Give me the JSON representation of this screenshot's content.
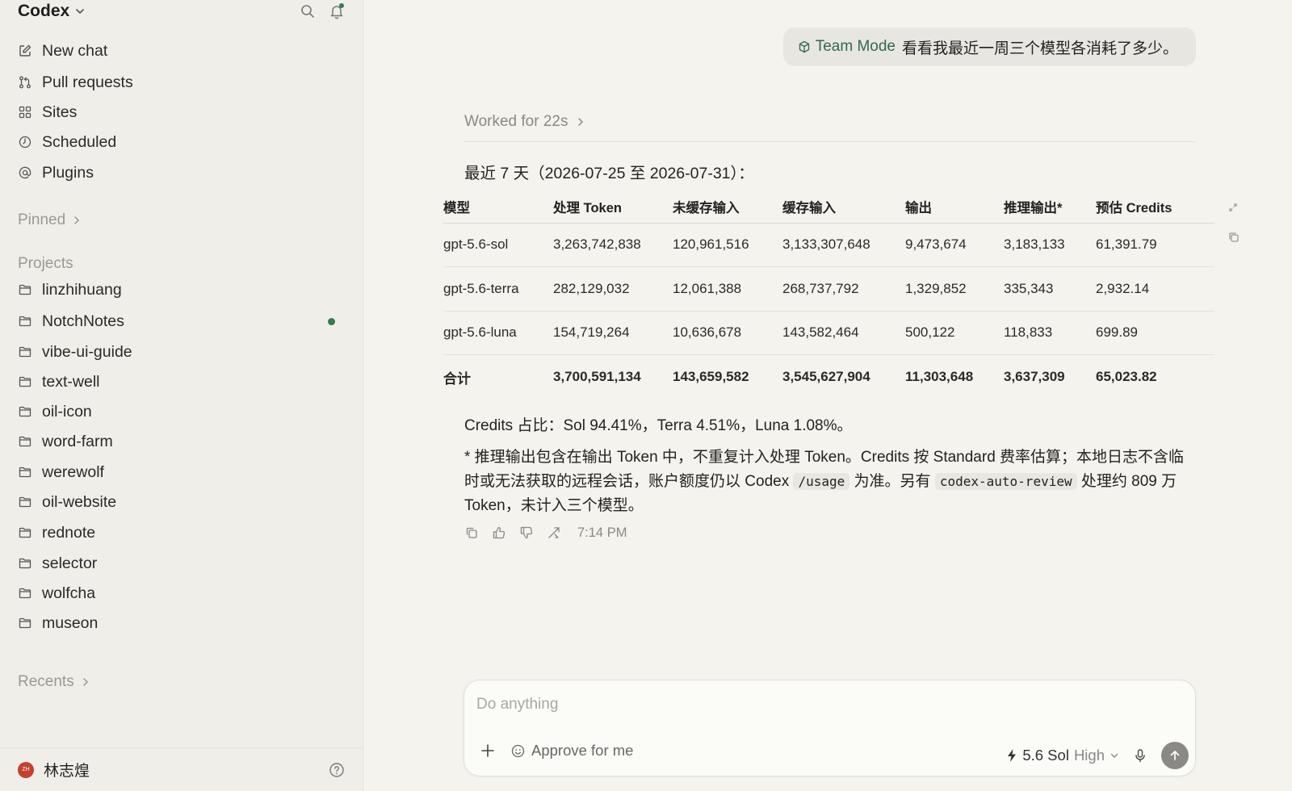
{
  "sidebar": {
    "app_title": "Codex",
    "nav": [
      {
        "label": "New chat",
        "icon": "compose-icon"
      },
      {
        "label": "Pull requests",
        "icon": "pull-request-icon"
      },
      {
        "label": "Sites",
        "icon": "grid-icon"
      },
      {
        "label": "Scheduled",
        "icon": "clock-icon"
      },
      {
        "label": "Plugins",
        "icon": "at-icon"
      }
    ],
    "pinned_label": "Pinned",
    "projects_label": "Projects",
    "projects": [
      "linzhihuang",
      "NotchNotes",
      "vibe-ui-guide",
      "text-well",
      "oil-icon",
      "word-farm",
      "werewolf",
      "oil-website",
      "rednote",
      "selector",
      "wolfcha",
      "museon"
    ],
    "recents_label": "Recents",
    "user": {
      "initials": "ZH",
      "name": "林志煌"
    }
  },
  "chat": {
    "user_message": {
      "mode": "Team Mode",
      "text": "看看我最近一周三个模型各消耗了多少。"
    },
    "worked_label": "Worked for 22s",
    "range_text": "最近 7 天（2026-07-25 至 2026-07-31）：",
    "table": {
      "headers": [
        "模型",
        "处理 Token",
        "未缓存输入",
        "缓存输入",
        "输出",
        "推理输出*",
        "预估 Credits"
      ],
      "rows": [
        [
          "gpt-5.6-sol",
          "3,263,742,838",
          "120,961,516",
          "3,133,307,648",
          "9,473,674",
          "3,183,133",
          "61,391.79"
        ],
        [
          "gpt-5.6-terra",
          "282,129,032",
          "12,061,388",
          "268,737,792",
          "1,329,852",
          "335,343",
          "2,932.14"
        ],
        [
          "gpt-5.6-luna",
          "154,719,264",
          "10,636,678",
          "143,582,464",
          "500,122",
          "118,833",
          "699.89"
        ]
      ],
      "total": [
        "合计",
        "3,700,591,134",
        "143,659,582",
        "3,545,627,904",
        "11,303,648",
        "3,637,309",
        "65,023.82"
      ]
    },
    "credits_share": "Credits 占比：Sol 94.41%，Terra 4.51%，Luna 1.08%。",
    "note": {
      "p1": "* 推理输出包含在输出 Token 中，不重复计入处理 Token。Credits 按 Standard 费率估算；本地日志不含临时或无法获取的远程会话，账户额度仍以 Codex ",
      "code1": "/usage",
      "p2": " 为准。另有 ",
      "code2": "codex-auto-review",
      "p3": " 处理约 809 万 Token，未计入三个模型。"
    },
    "timestamp": "7:14 PM"
  },
  "composer": {
    "placeholder": "Do anything",
    "approve_label": "Approve for me",
    "model": "5.6 Sol",
    "level": "High"
  },
  "colors": {
    "accent_green": "#2e7d4f",
    "mode_green": "#2f6b4d",
    "avatar_red": "#c6402d"
  }
}
